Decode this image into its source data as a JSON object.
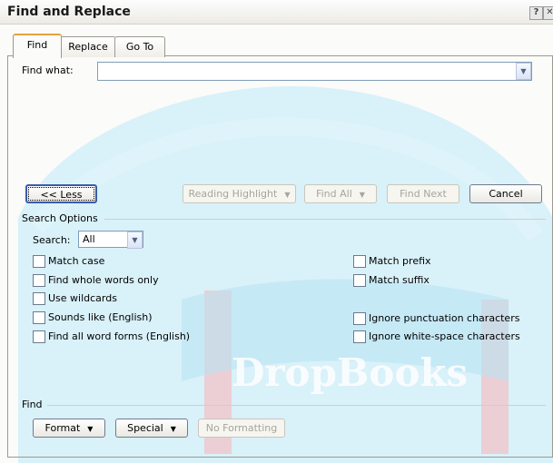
{
  "window": {
    "title": "Find and Replace"
  },
  "tabs": {
    "find": "Find",
    "replace": "Replace",
    "goto": "Go To"
  },
  "find_what": {
    "label": "Find what:",
    "value": ""
  },
  "buttons": {
    "less": "<< Less",
    "reading_highlight": "Reading Highlight",
    "find_all": "Find All",
    "find_next": "Find Next",
    "cancel": "Cancel",
    "format": "Format",
    "special": "Special",
    "no_formatting": "No Formatting"
  },
  "search_options": {
    "heading": "Search Options",
    "search_label": "Search:",
    "search_value": "All",
    "options_left": [
      {
        "label": "Match case",
        "checked": false
      },
      {
        "label": "Find whole words only",
        "checked": false
      },
      {
        "label": "Use wildcards",
        "checked": false
      },
      {
        "label": "Sounds like (English)",
        "checked": false
      },
      {
        "label": "Find all word forms (English)",
        "checked": false
      }
    ],
    "options_right": [
      {
        "label": "Match prefix",
        "checked": false
      },
      {
        "label": "Match suffix",
        "checked": false
      },
      {
        "label": "Ignore punctuation characters",
        "checked": false
      },
      {
        "label": "Ignore white-space characters",
        "checked": false
      }
    ]
  },
  "find_section": {
    "heading": "Find"
  },
  "watermark": {
    "text": "DropBooks"
  },
  "colors": {
    "tab_highlight": "#e7a33a",
    "input_border": "#7f9db9",
    "watermark_blue": "#c9ecf7",
    "watermark_pink": "#f4c6cc"
  }
}
